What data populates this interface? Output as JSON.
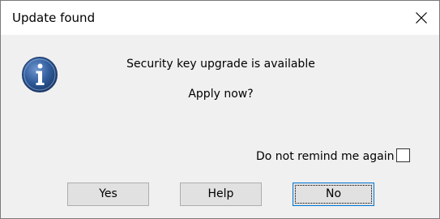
{
  "window": {
    "title": "Update found",
    "close_icon": "close-icon"
  },
  "message": {
    "icon": "info-icon",
    "main": "Security key upgrade is available",
    "sub": "Apply now?"
  },
  "remind": {
    "label": "Do not remind me again",
    "checked": false
  },
  "buttons": {
    "yes": "Yes",
    "help": "Help",
    "no": "No"
  },
  "colors": {
    "dialog_bg": "#f0f0f0",
    "titlebar_bg": "#ffffff",
    "button_bg": "#e1e1e1",
    "focus_border": "#0078d7",
    "icon_blue": "#2f5b9a"
  }
}
